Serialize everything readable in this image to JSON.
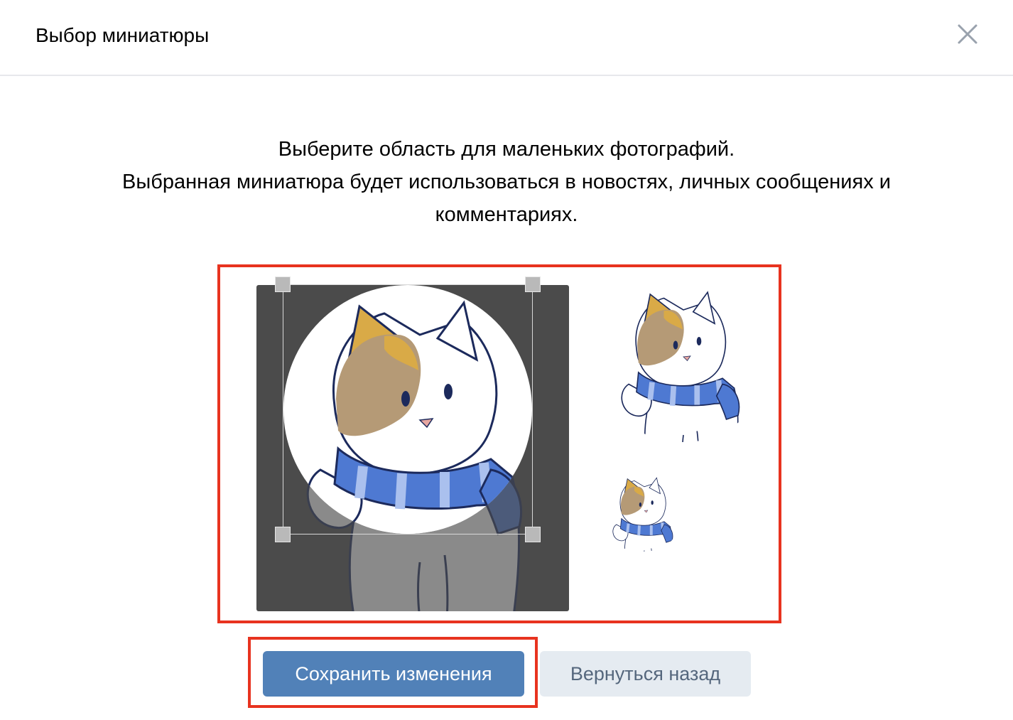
{
  "dialog": {
    "title": "Выбор миниатюры",
    "close_icon": "close-icon"
  },
  "instructions": {
    "line1": "Выберите область для маленьких фотографий.",
    "line2": "Выбранная миниатюра будет использоваться в новостях, личных сообщениях и комментариях."
  },
  "crop": {
    "image_subject": "cartoon cat with blue scarf",
    "overlay_color": "#4b4b4b",
    "highlight_color": "#e8331f"
  },
  "buttons": {
    "save_label": "Сохранить изменения",
    "back_label": "Вернуться назад"
  },
  "colors": {
    "primary": "#5181b8",
    "secondary_bg": "#e5ebf1",
    "secondary_text": "#55677d",
    "accent_highlight": "#e8331f",
    "divider": "#e7e8ec"
  }
}
